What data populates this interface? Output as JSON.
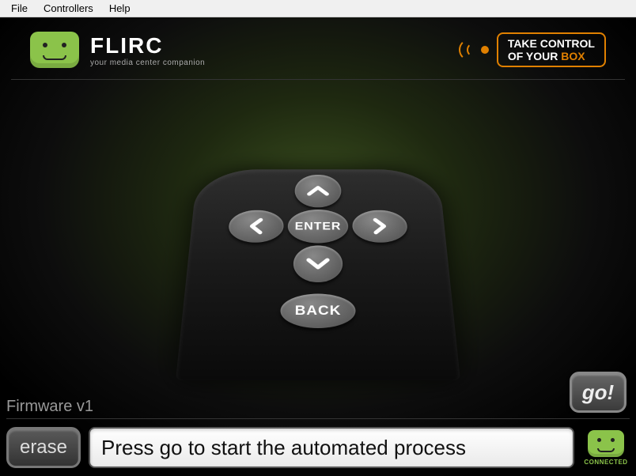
{
  "menu": {
    "file": "File",
    "controllers": "Controllers",
    "help": "Help"
  },
  "branding": {
    "title": "FLIRC",
    "subtitle": "your media center companion",
    "take_control_line1": "TAKE CONTROL",
    "take_control_line2_pre": "OF YOUR ",
    "take_control_line2_accent": "BOX"
  },
  "remote": {
    "enter": "ENTER",
    "back": "BACK"
  },
  "firmware_label": "Firmware v1",
  "go_label": "go!",
  "erase_label": "erase",
  "status_message": "Press go to start the automated process",
  "connection_label": "CONNECTED"
}
